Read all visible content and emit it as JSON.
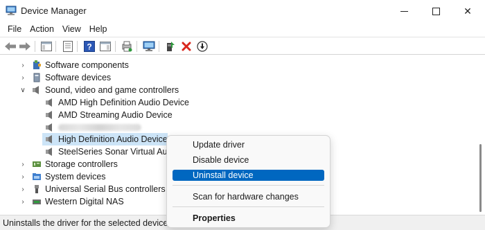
{
  "window": {
    "title": "Device Manager",
    "icon": "device-manager-icon",
    "controls": {
      "minimize": "minimize-icon",
      "maximize": "maximize-icon",
      "close": "✕"
    }
  },
  "menu": [
    "File",
    "Action",
    "View",
    "Help"
  ],
  "toolbar": {
    "buttons": [
      "back-arrow-icon",
      "forward-arrow-icon",
      "show-hide-console-tree-icon",
      "properties-icon",
      "help-icon",
      "action-pane-icon",
      "update-driver-icon",
      "scan-hardware-icon",
      "enable-device-icon",
      "uninstall-device-icon",
      "disable-device-icon"
    ]
  },
  "tree": {
    "items": [
      {
        "label": "Software components",
        "icon": "puzzle-icon",
        "expanded": false
      },
      {
        "label": "Software devices",
        "icon": "device-icon",
        "expanded": false
      },
      {
        "label": "Sound, video and game controllers",
        "icon": "speaker-icon",
        "expanded": true
      },
      {
        "label": "AMD High Definition Audio Device",
        "icon": "speaker-icon",
        "child": true
      },
      {
        "label": "AMD Streaming Audio Device",
        "icon": "speaker-icon",
        "child": true
      },
      {
        "label": "",
        "icon": "speaker-icon",
        "child": true,
        "blurred": true
      },
      {
        "label": "High Definition Audio Device",
        "icon": "speaker-icon",
        "child": true,
        "selected": true
      },
      {
        "label": "SteelSeries Sonar Virtual Audi",
        "icon": "speaker-icon",
        "child": true
      },
      {
        "label": "Storage controllers",
        "icon": "storage-icon",
        "expanded": false
      },
      {
        "label": "System devices",
        "icon": "folder-icon",
        "expanded": false
      },
      {
        "label": "Universal Serial Bus controllers",
        "icon": "usb-icon",
        "expanded": false
      },
      {
        "label": "Western Digital NAS",
        "icon": "nas-icon",
        "expanded": false
      }
    ]
  },
  "context_menu": {
    "items": [
      "Update driver",
      "Disable device",
      "Uninstall device",
      "Scan for hardware changes",
      "Properties"
    ],
    "highlighted": "Uninstall device"
  },
  "status": {
    "text": "Uninstalls the driver for the selected device."
  },
  "colors": {
    "selection": "#cce4f7",
    "highlight": "#0067c0",
    "accent_red": "#d9261c"
  }
}
